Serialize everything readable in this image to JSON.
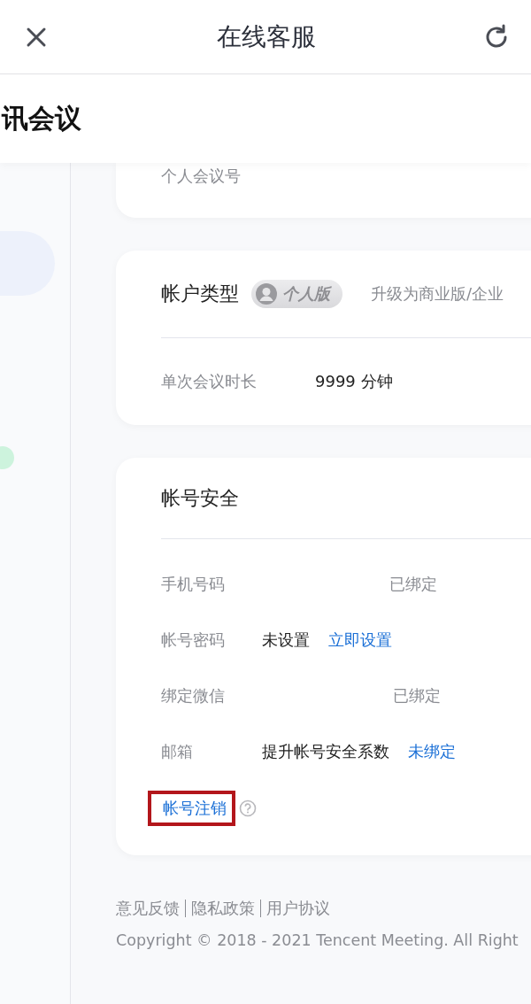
{
  "header": {
    "title": "在线客服"
  },
  "app_bar": {
    "title": "讯会议"
  },
  "personal_card": {
    "rows": [
      {
        "label": "个人会议号"
      }
    ]
  },
  "account_card": {
    "title": "帐户类型",
    "badge": "个人版",
    "upgrade_link": "升级为商业版/企业",
    "rows": [
      {
        "label": "单次会议时长",
        "value": "9999 分钟"
      }
    ]
  },
  "security_card": {
    "title": "帐号安全",
    "rows": [
      {
        "kind": "status",
        "label": "手机号码",
        "status": "已绑定"
      },
      {
        "kind": "action",
        "label": "帐号密码",
        "value": "未设置",
        "action": "立即设置"
      },
      {
        "kind": "status",
        "label": "绑定微信",
        "status": "已绑定"
      },
      {
        "kind": "action",
        "label": "邮箱",
        "value": "提升帐号安全系数",
        "action": "未绑定"
      }
    ],
    "deregister": {
      "label": "帐号注销",
      "highlighted": true
    }
  },
  "footer": {
    "links": [
      "意见反馈",
      "隐私政策",
      "用户协议"
    ],
    "copyright": "Copyright © 2018 - 2021 Tencent Meeting. All Right"
  }
}
